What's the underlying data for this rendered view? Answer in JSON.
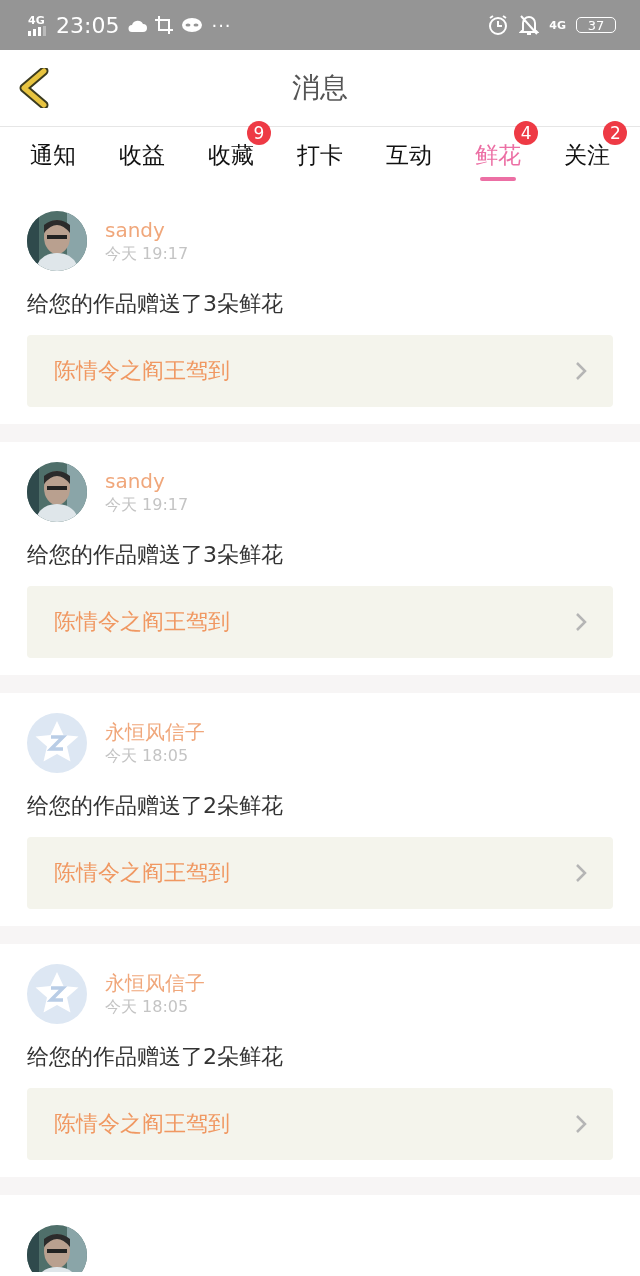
{
  "status_bar": {
    "network": "4G",
    "time": "23:05",
    "dots": "···",
    "network_right": "4G",
    "battery": "37"
  },
  "header": {
    "title": "消息"
  },
  "tabs": [
    {
      "label": "通知",
      "selected": false
    },
    {
      "label": "收益",
      "selected": false
    },
    {
      "label": "收藏",
      "selected": false,
      "badge": "9"
    },
    {
      "label": "打卡",
      "selected": false
    },
    {
      "label": "互动",
      "selected": false
    },
    {
      "label": "鲜花",
      "selected": true,
      "badge": "4"
    },
    {
      "label": "关注",
      "selected": false,
      "badge": "2"
    }
  ],
  "messages": [
    {
      "kind": "picture",
      "name": "sandy",
      "time": "今天 19:17",
      "text": "给您的作品赠送了3朵鲜花",
      "work": "陈情令之阎王驾到"
    },
    {
      "kind": "picture",
      "name": "sandy",
      "time": "今天 19:17",
      "text": "给您的作品赠送了3朵鲜花",
      "work": "陈情令之阎王驾到"
    },
    {
      "kind": "default",
      "name": "永恒风信子",
      "time": "今天 18:05",
      "text": "给您的作品赠送了2朵鲜花",
      "work": "陈情令之阎王驾到"
    },
    {
      "kind": "default",
      "name": "永恒风信子",
      "time": "今天 18:05",
      "text": "给您的作品赠送了2朵鲜花",
      "work": "陈情令之阎王驾到"
    },
    {
      "kind": "picture",
      "partial": true
    }
  ]
}
